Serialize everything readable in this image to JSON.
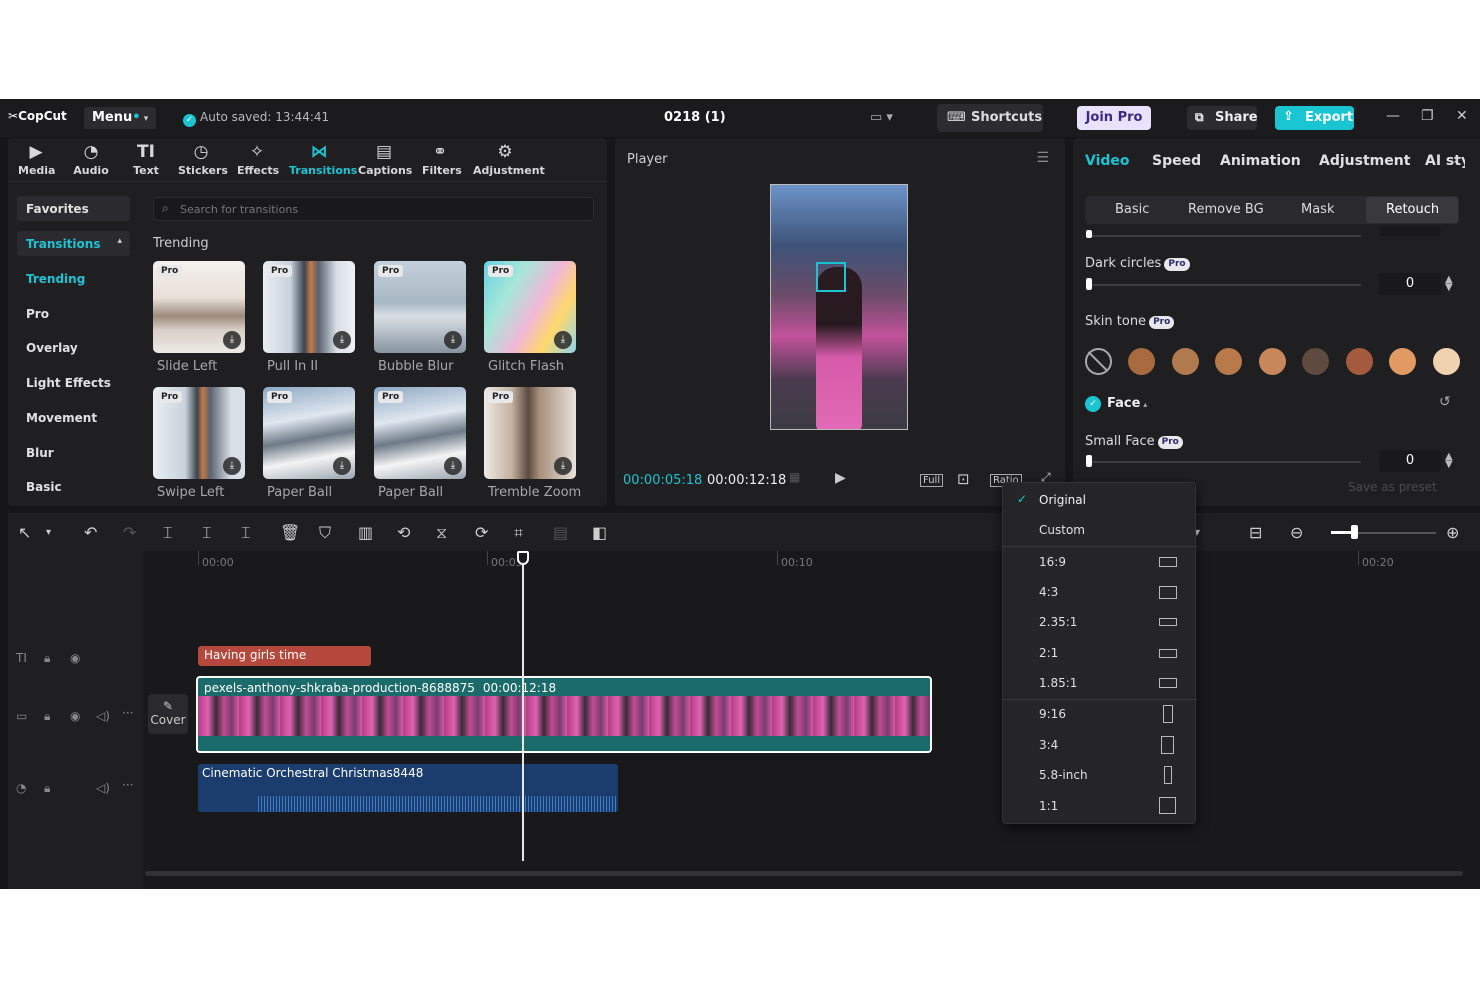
{
  "titlebar": {
    "logo": "CopCut",
    "menu_label": "Menu",
    "auto_saved": "Auto saved: 13:44:41",
    "project_title": "0218 (1)",
    "shortcuts_label": "Shortcuts",
    "join_pro_label": "Join Pro",
    "share_label": "Share",
    "export_label": "Export"
  },
  "toolbar": {
    "tabs": [
      {
        "label": "Media",
        "icon": "media-icon"
      },
      {
        "label": "Audio",
        "icon": "audio-icon"
      },
      {
        "label": "Text",
        "icon": "text-icon"
      },
      {
        "label": "Stickers",
        "icon": "stickers-icon"
      },
      {
        "label": "Effects",
        "icon": "effects-icon"
      },
      {
        "label": "Transitions",
        "icon": "transitions-icon"
      },
      {
        "label": "Captions",
        "icon": "captions-icon"
      },
      {
        "label": "Filters",
        "icon": "filters-icon"
      },
      {
        "label": "Adjustment",
        "icon": "adjustment-icon"
      }
    ],
    "active_tab": "Transitions"
  },
  "transitions_panel": {
    "categories": [
      "Favorites",
      "Transitions",
      "Trending",
      "Pro",
      "Overlay",
      "Light Effects",
      "Movement",
      "Blur",
      "Basic"
    ],
    "search_placeholder": "Search for transitions",
    "section_title": "Trending",
    "pro_badge": "Pro",
    "items": [
      {
        "name": "Slide Left"
      },
      {
        "name": "Pull In II"
      },
      {
        "name": "Bubble Blur"
      },
      {
        "name": "Glitch Flash"
      },
      {
        "name": "Swipe Left"
      },
      {
        "name": "Paper Ball"
      },
      {
        "name": "Paper Ball"
      },
      {
        "name": "Tremble Zoom"
      }
    ]
  },
  "player": {
    "title": "Player",
    "current_time": "00:00:05:18",
    "total_time": "00:00:12:18",
    "full_label": "Full",
    "ratio_label": "Ratio"
  },
  "properties": {
    "tabs": [
      "Video",
      "Speed",
      "Animation",
      "Adjustment",
      "AI styli"
    ],
    "active_tab": "Video",
    "subtabs": [
      "Basic",
      "Remove BG",
      "Mask",
      "Retouch"
    ],
    "active_subtab": "Retouch",
    "dark_circles_label": "Dark circles",
    "dark_circles_value": "0",
    "skin_tone_label": "Skin tone",
    "skin_tones": [
      "#a86b3f",
      "#b07a4e",
      "#b87a4a",
      "#c7875a",
      "#5e4a3e",
      "#a45a3c",
      "#e09a62",
      "#f1d2b0"
    ],
    "face_label": "Face",
    "small_face_label": "Small Face",
    "small_face_value": "0",
    "pro_badge": "Pro",
    "save_preset_label": "Save as preset"
  },
  "timeline": {
    "ruler": [
      "00:00",
      "00:05",
      "00:10",
      "00:20"
    ],
    "text_clip": "Having girls time",
    "video_clip_name": "pexels-anthony-shkraba-production-8688875",
    "video_clip_duration": "00:00:12:18",
    "cover_label": "Cover",
    "audio_clip": "Cinematic Orchestral Christmas8448"
  },
  "ratio_menu": {
    "items": [
      "Original",
      "Custom",
      "16:9",
      "4:3",
      "2.35:1",
      "2:1",
      "1.85:1",
      "9:16",
      "3:4",
      "5.8-inch",
      "1:1"
    ],
    "selected": "Original"
  },
  "colors": {
    "accent": "#19c5d0",
    "background": "#161618",
    "panel": "#1f1f22"
  }
}
